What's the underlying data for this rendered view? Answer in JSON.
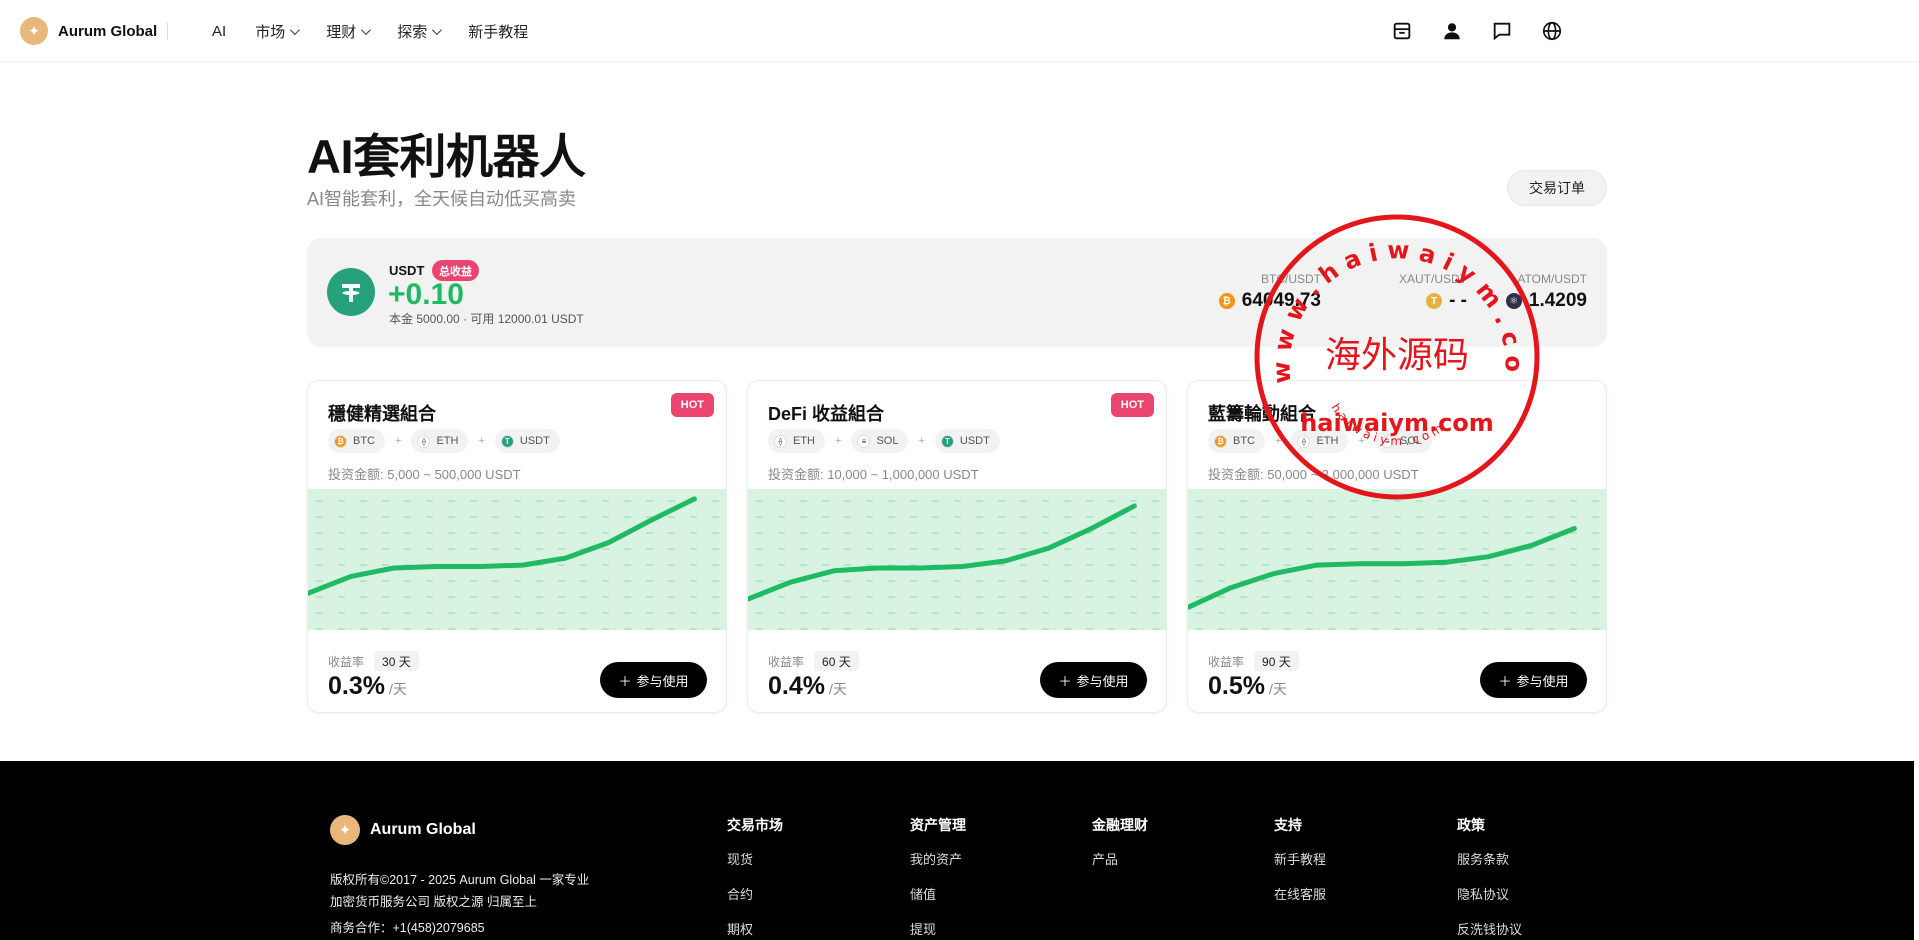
{
  "header": {
    "brand_name": "Aurum Global",
    "brand_icon": "✦",
    "nav": [
      {
        "label": "AI",
        "dropdown": false
      },
      {
        "label": "市场",
        "dropdown": true
      },
      {
        "label": "理财",
        "dropdown": true
      },
      {
        "label": "探索",
        "dropdown": true
      },
      {
        "label": "新手教程",
        "dropdown": false
      }
    ],
    "icons": [
      "inbox-icon",
      "user-icon",
      "chat-icon",
      "globe-icon"
    ]
  },
  "page": {
    "title": "AI套利机器人",
    "subtitle": "AI智能套利，全天候自动低买高卖",
    "orders_button": "交易订单"
  },
  "summary": {
    "currency": "USDT",
    "badge": "总收益",
    "profit": "+0.10",
    "detail": "本金 5000.00 · 可用 12000.01 USDT",
    "tickers": [
      {
        "pair": "BTC/USDT",
        "price": "64049.73",
        "color": "#f7931a",
        "glyph": "₿"
      },
      {
        "pair": "XAUT/USDT",
        "price": "- -",
        "color": "#e3b341",
        "glyph": "T"
      },
      {
        "pair": "ATOM/USDT",
        "price": "1.4209",
        "color": "#2e3148",
        "glyph": "⚛"
      }
    ]
  },
  "cards": [
    {
      "title": "穩健精選組合",
      "badge": "HOT",
      "coins": [
        {
          "name": "BTC",
          "color": "#f7931a",
          "glyph": "₿"
        },
        {
          "name": "ETH",
          "color": "#ffffff",
          "glyph": "⟠"
        },
        {
          "name": "USDT",
          "color": "#26a17b",
          "glyph": "T"
        }
      ],
      "invest": "投资金额: 5,000 ~ 500,000 USDT",
      "rate_label": "收益率",
      "days": "30 天",
      "rate": "0.3%",
      "unit": "/天",
      "button": "参与使用",
      "curve": [
        0.26,
        0.38,
        0.44,
        0.45,
        0.45,
        0.46,
        0.51,
        0.62,
        0.78,
        0.93
      ]
    },
    {
      "title": "DeFi 收益組合",
      "badge": "HOT",
      "coins": [
        {
          "name": "ETH",
          "color": "#ffffff",
          "glyph": "⟠"
        },
        {
          "name": "SOL",
          "color": "#ffffff",
          "glyph": "≡"
        },
        {
          "name": "USDT",
          "color": "#26a17b",
          "glyph": "T"
        }
      ],
      "invest": "投资金额: 10,000 ~ 1,000,000 USDT",
      "rate_label": "收益率",
      "days": "60 天",
      "rate": "0.4%",
      "unit": "/天",
      "button": "参与使用",
      "curve": [
        0.22,
        0.34,
        0.42,
        0.44,
        0.44,
        0.45,
        0.49,
        0.58,
        0.72,
        0.88
      ]
    },
    {
      "title": "藍籌輪動組合",
      "badge": "",
      "coins": [
        {
          "name": "BTC",
          "color": "#f7931a",
          "glyph": "₿"
        },
        {
          "name": "ETH",
          "color": "#ffffff",
          "glyph": "⟠"
        },
        {
          "name": "SOL",
          "color": "#ffffff",
          "glyph": "≡"
        }
      ],
      "invest": "投资金额: 50,000 ~ 3,000,000 USDT",
      "rate_label": "收益率",
      "days": "90 天",
      "rate": "0.5%",
      "unit": "/天",
      "button": "参与使用",
      "curve": [
        0.16,
        0.3,
        0.4,
        0.46,
        0.47,
        0.47,
        0.48,
        0.52,
        0.6,
        0.72
      ]
    }
  ],
  "stamp": {
    "top_text": "w w w . h a i w a i y m . c o m",
    "center_text": "海外源码",
    "bottom_text": "haiwaiym.com",
    "small_text": "h a i w a i y m . c o m",
    "color": "#e4161b"
  },
  "footer": {
    "brand_name": "Aurum Global",
    "copyright_1": "版权所有©2017 - 2025 Aurum Global 一家专业",
    "copyright_2": "加密货币服务公司 版权之源 归属至上",
    "business": "商务合作：+1(458)2079685",
    "columns": [
      {
        "title": "交易市场",
        "links": [
          "现货",
          "合约",
          "期权"
        ]
      },
      {
        "title": "资产管理",
        "links": [
          "我的资产",
          "储值",
          "提现"
        ]
      },
      {
        "title": "金融理财",
        "links": [
          "产品"
        ]
      },
      {
        "title": "支持",
        "links": [
          "新手教程",
          "在线客服"
        ]
      },
      {
        "title": "政策",
        "links": [
          "服务条款",
          "隐私协议",
          "反洗钱协议"
        ]
      }
    ]
  }
}
